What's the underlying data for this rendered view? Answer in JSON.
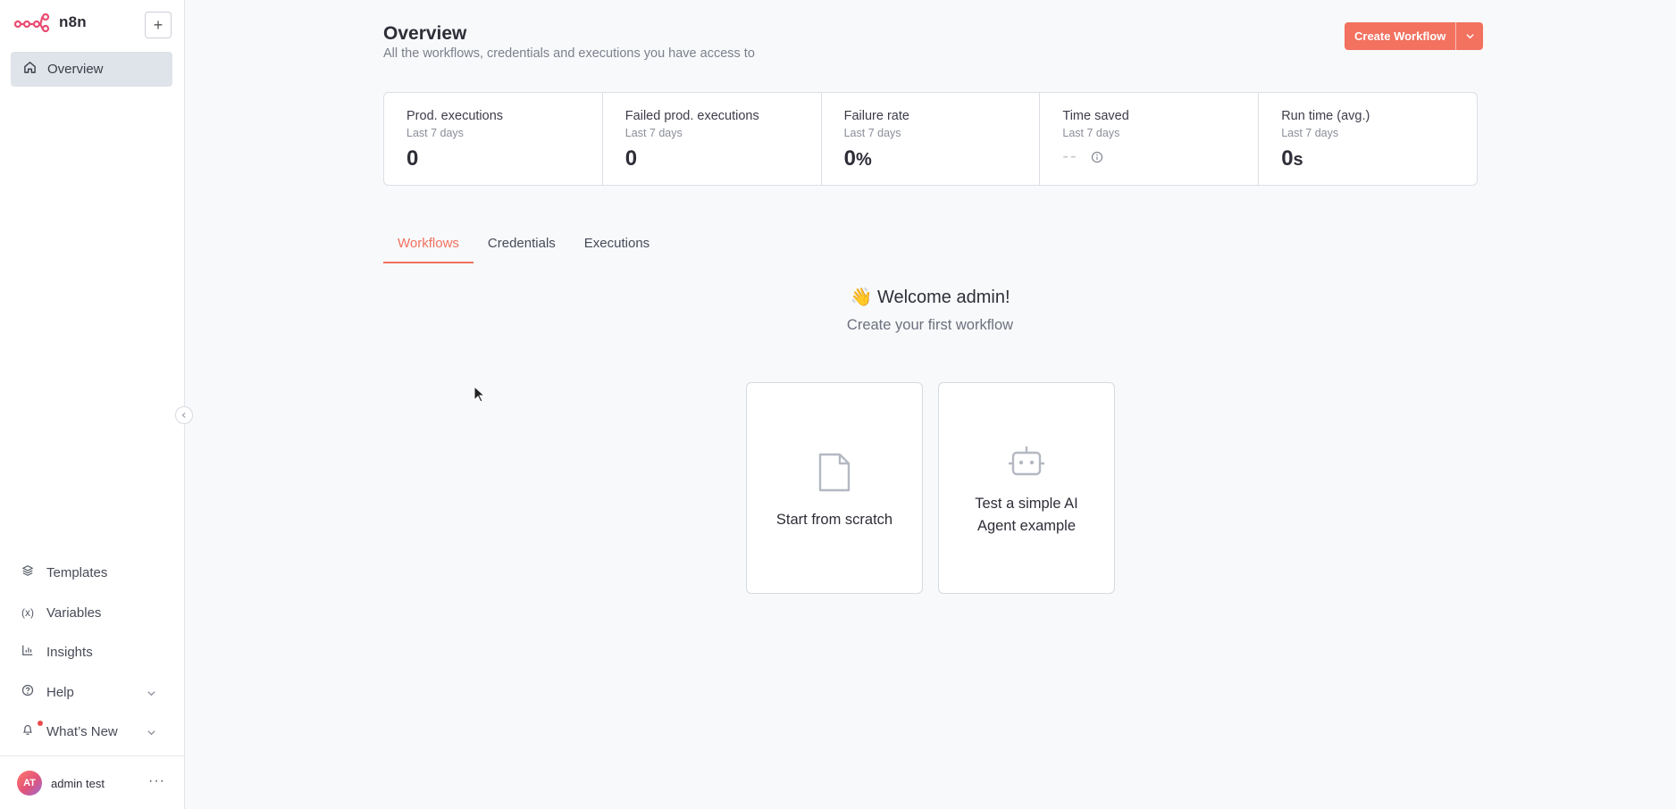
{
  "app": {
    "name": "n8n",
    "brand_color": "#ea4b71",
    "accent_color": "#f2715f"
  },
  "sidebar": {
    "add_label": "+",
    "active_item": {
      "label": "Overview",
      "icon": "home-icon"
    },
    "bottom_items": [
      {
        "label": "Templates",
        "icon": "layers-icon"
      },
      {
        "label": "Variables",
        "icon": "variables-icon"
      },
      {
        "label": "Insights",
        "icon": "chart-icon"
      },
      {
        "label": "Help",
        "icon": "help-icon"
      },
      {
        "label": "What’s New",
        "icon": "bell-icon"
      }
    ],
    "user": {
      "initials": "AT",
      "name": "admin test",
      "menu": "···"
    }
  },
  "header": {
    "title": "Overview",
    "subtitle": "All the workflows, credentials and executions you have access to",
    "create_label": "Create Workflow"
  },
  "stats": [
    {
      "label": "Prod. executions",
      "period": "Last 7 days",
      "value": "0",
      "unit": ""
    },
    {
      "label": "Failed prod. executions",
      "period": "Last 7 days",
      "value": "0",
      "unit": ""
    },
    {
      "label": "Failure rate",
      "period": "Last 7 days",
      "value": "0",
      "unit": "%"
    },
    {
      "label": "Time saved",
      "period": "Last 7 days",
      "value": "--",
      "unit": ""
    },
    {
      "label": "Run time (avg.)",
      "period": "Last 7 days",
      "value": "0",
      "unit": "s"
    }
  ],
  "tabs": [
    "Workflows",
    "Credentials",
    "Executions"
  ],
  "welcome": {
    "emoji": "👋",
    "title": "Welcome admin!",
    "subtitle": "Create your first workflow"
  },
  "cards": [
    {
      "label": "Start from scratch",
      "icon": "file-icon"
    },
    {
      "label_line1": "Test a simple AI",
      "label_line2": "Agent example",
      "icon": "robot-icon"
    }
  ]
}
